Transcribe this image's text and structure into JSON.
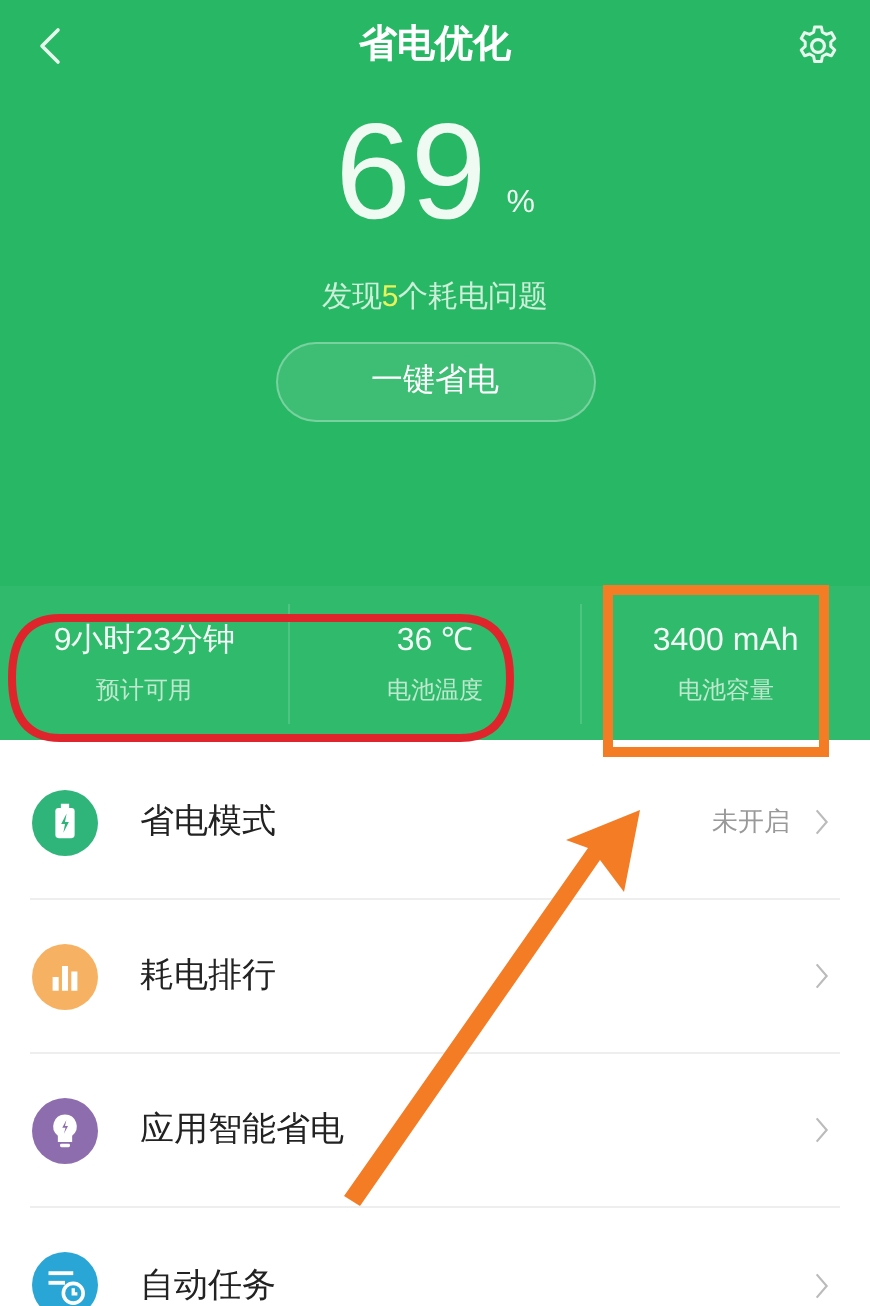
{
  "header": {
    "title": "省电优化",
    "percent": "69",
    "percent_unit": "%",
    "issues": {
      "before": "发现",
      "count": "5",
      "after": "个耗电问题"
    },
    "button": "一键省电"
  },
  "stats": [
    {
      "value": "9小时23分钟",
      "label": "预计可用"
    },
    {
      "value": "36 ℃",
      "label": "电池温度"
    },
    {
      "value": "3400 mAh",
      "label": "电池容量"
    }
  ],
  "menu": [
    {
      "kind": "battery",
      "color": "#2fb47a",
      "label": "省电模式",
      "status": "未开启"
    },
    {
      "kind": "chart",
      "color": "#f6b262",
      "label": "耗电排行"
    },
    {
      "kind": "bulb",
      "color": "#8e6dae",
      "label": "应用智能省电"
    },
    {
      "kind": "tasks",
      "color": "#2aa6d6",
      "label": "自动任务"
    }
  ],
  "annotations": [
    {
      "kind": "ellipse",
      "color": "#e0242c"
    },
    {
      "kind": "rectangle",
      "color": "#f47c24"
    },
    {
      "kind": "arrow",
      "color": "#f47c24"
    }
  ]
}
